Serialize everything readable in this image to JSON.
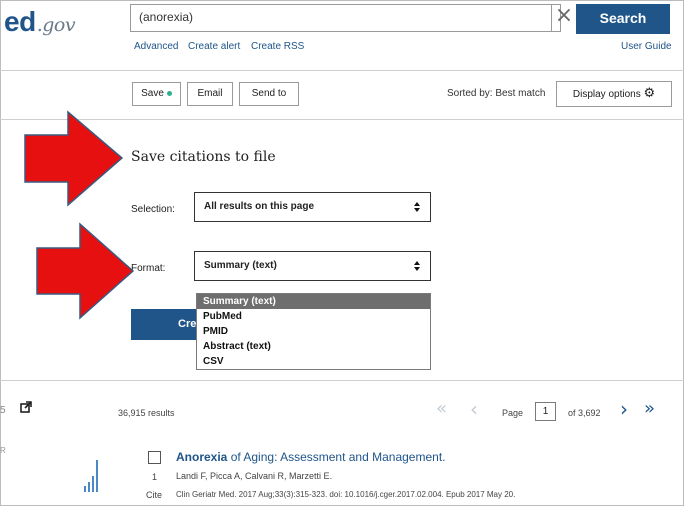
{
  "header": {
    "logo_main": "ed",
    "logo_suffix": ".gov",
    "search_value": "(anorexia)",
    "clear_symbol": "×",
    "search_label": "Search",
    "links": [
      "Advanced",
      "Create alert",
      "Create RSS"
    ],
    "user_guide": "User Guide"
  },
  "toolbar": {
    "save_label": "Save",
    "email_label": "Email",
    "send_to_label": "Send to",
    "sorted_by": "Sorted by: Best match",
    "display_options_label": "Display options",
    "gear_symbol": "⚙"
  },
  "save_panel": {
    "title": "Save citations to file",
    "selection_label": "Selection:",
    "selection_value": "All results on this page",
    "format_label": "Format:",
    "format_value": "Summary (text)",
    "create_label": "Cre",
    "format_options": [
      "Summary (text)",
      "PubMed",
      "PMID",
      "Abstract (text)",
      "CSV"
    ],
    "selected_option": "Summary (text)"
  },
  "results": {
    "count_text": "36,915 results",
    "page_label": "Page",
    "page_value": "1",
    "of_pages": "of 3,692",
    "first_symbol": "«",
    "prev_symbol": "‹",
    "next_symbol": "›",
    "last_symbol": "»",
    "left_fragment_1": "5",
    "left_fragment_2": "R",
    "items": [
      {
        "number": "1",
        "cite_label": "Cite",
        "title_highlight": "Anorexia",
        "title_rest": " of Aging: Assessment and Management.",
        "authors": "Landi F, Picca A, Calvani R, Marzetti E.",
        "citation": "Clin Geriatr Med. 2017 Aug;33(3):315-323. doi: 10.1016/j.cger.2017.02.004. Epub 2017 May 20."
      }
    ]
  },
  "annotations": {
    "arrow_color": "#e61010",
    "arrow_outline": "#3a5a80",
    "arrow_count": 2
  },
  "colors": {
    "brand_blue": "#20558a",
    "save_dot": "#2bb08b",
    "dropdown_highlight": "#6e6e6e"
  }
}
